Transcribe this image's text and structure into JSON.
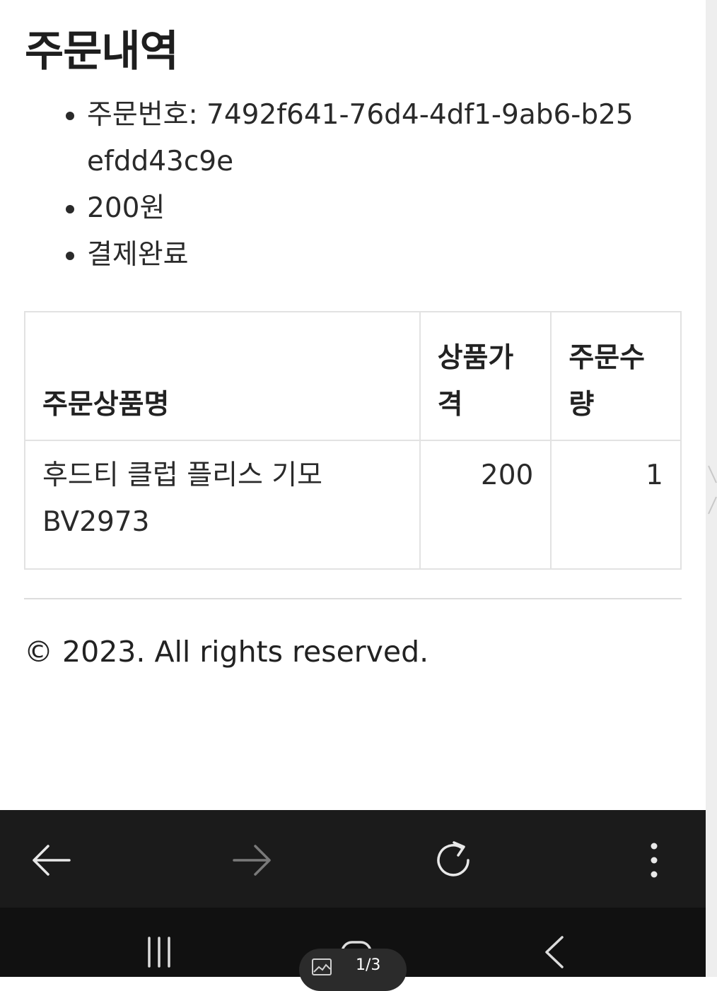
{
  "page": {
    "title": "주문내역",
    "summary": {
      "order_number": "주문번호: 7492f641-76d4-4df1-9ab6-b25efdd43c9e",
      "amount": "200원",
      "status": "결제완료"
    },
    "table": {
      "headers": [
        "주문상품명",
        "상품가격",
        "주문수량"
      ],
      "rows": [
        {
          "name": "후드티 클럽 플리스 기모 BV2973",
          "price": "200",
          "quantity": "1"
        }
      ]
    },
    "footer": "© 2023. All rights reserved."
  },
  "browser_toolbar": {
    "buttons": [
      "back-icon",
      "forward-icon",
      "reload-icon",
      "more-icon"
    ]
  },
  "system_nav": {
    "buttons": [
      "recents-icon",
      "home-icon",
      "back-icon"
    ],
    "pager": {
      "text": "1/3",
      "icon": "image-icon"
    }
  },
  "colors": {
    "toolbar_bg": "#1b1b1b",
    "navbar_bg": "#111111",
    "table_border": "#e2e2e2"
  }
}
